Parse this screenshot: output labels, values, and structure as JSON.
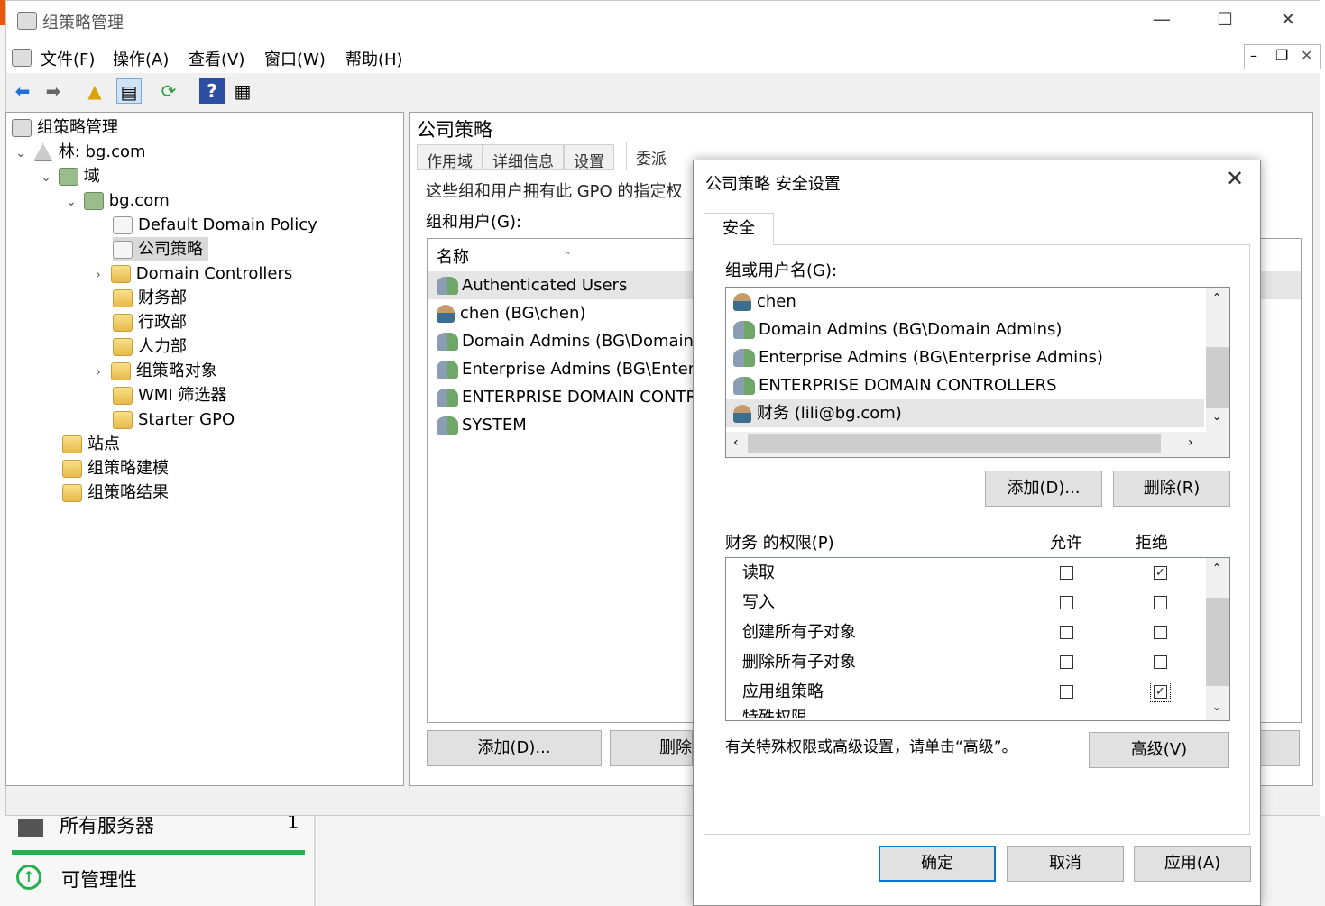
{
  "window": {
    "title": "组策略管理"
  },
  "menu": [
    "文件(F)",
    "操作(A)",
    "查看(V)",
    "窗口(W)",
    "帮助(H)"
  ],
  "tree": [
    {
      "label": "组策略管理",
      "icon": "gpmc-root-icon"
    },
    {
      "label": "林: bg.com",
      "icon": "forest-icon"
    },
    {
      "label": "域",
      "icon": "domains-icon"
    },
    {
      "label": "bg.com",
      "icon": "domain-icon"
    },
    {
      "label": "Default Domain Policy",
      "icon": "gpo-link-icon"
    },
    {
      "label": "公司策略",
      "icon": "gpo-link-icon",
      "selected": true
    },
    {
      "label": "Domain Controllers",
      "icon": "ou-folder-icon"
    },
    {
      "label": "财务部",
      "icon": "ou-folder-icon"
    },
    {
      "label": "行政部",
      "icon": "ou-folder-icon"
    },
    {
      "label": "人力部",
      "icon": "ou-folder-icon"
    },
    {
      "label": "组策略对象",
      "icon": "gpo-container-icon"
    },
    {
      "label": "WMI 筛选器",
      "icon": "wmi-filter-icon"
    },
    {
      "label": "Starter GPO",
      "icon": "starter-gpo-icon"
    },
    {
      "label": "站点",
      "icon": "sites-icon"
    },
    {
      "label": "组策略建模",
      "icon": "modeling-icon"
    },
    {
      "label": "组策略结果",
      "icon": "results-icon"
    }
  ],
  "right": {
    "title": "公司策略",
    "tabs": [
      "作用域",
      "详细信息",
      "设置",
      "委派"
    ],
    "desc": "这些组和用户拥有此 GPO 的指定权",
    "group_label": "组和用户(G):",
    "col_name": "名称",
    "rows": [
      "Authenticated Users",
      "chen (BG\\chen)",
      "Domain Admins (BG\\Domain A...",
      "Enterprise Admins (BG\\Enterpri...",
      "ENTERPRISE DOMAIN CONTR...",
      "SYSTEM"
    ],
    "add_btn": "添加(D)...",
    "remove_btn_partial": "删除"
  },
  "dialog": {
    "title": "公司策略 安全设置",
    "tab": "安全",
    "group_label": "组或用户名(G):",
    "groups": [
      {
        "name": "chen",
        "type": "user"
      },
      {
        "name": "Domain Admins (BG\\Domain Admins)",
        "type": "group"
      },
      {
        "name": "Enterprise Admins (BG\\Enterprise Admins)",
        "type": "group"
      },
      {
        "name": "ENTERPRISE DOMAIN CONTROLLERS",
        "type": "group"
      },
      {
        "name": "财务 (lili@bg.com)",
        "type": "user",
        "selected": true
      }
    ],
    "add_btn": "添加(D)...",
    "remove_btn": "删除(R)",
    "perm_label": "财务 的权限(P)",
    "allow": "允许",
    "deny": "拒绝",
    "perms": [
      {
        "name": "读取",
        "allow": false,
        "deny": true
      },
      {
        "name": "写入",
        "allow": false,
        "deny": false
      },
      {
        "name": "创建所有子对象",
        "allow": false,
        "deny": false
      },
      {
        "name": "删除所有子对象",
        "allow": false,
        "deny": false
      },
      {
        "name": "应用组策略",
        "allow": false,
        "deny": true
      },
      {
        "name": "特殊权限",
        "allow": false,
        "deny": false
      }
    ],
    "note": "有关特殊权限或高级设置，请单击“高级”。",
    "advanced_btn": "高级(V)",
    "ok": "确定",
    "cancel": "取消",
    "apply": "应用(A)"
  },
  "background": {
    "servers_label": "所有服务器",
    "servers_count": "1",
    "manageability": "可管理性"
  }
}
